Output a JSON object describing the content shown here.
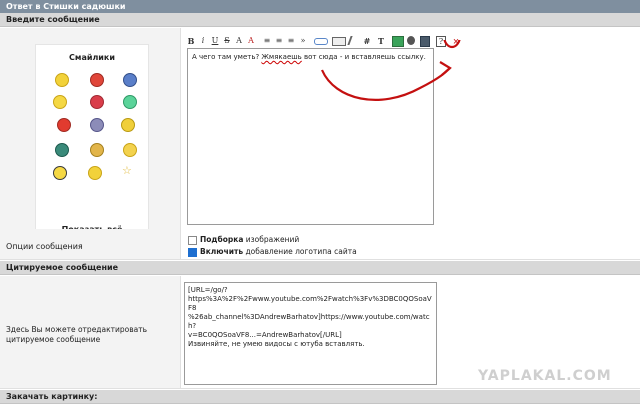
{
  "window": {
    "title": "Ответ в Стишки садюшки"
  },
  "sections": {
    "message": "Введите сообщение",
    "quoted": "Цитируемое сообщение",
    "upload": "Закачать картинку:"
  },
  "smileys": {
    "title": "Смайлики",
    "show_all": "Показать всё",
    "icons": [
      "smiley-icon",
      "smiley-icon",
      "smiley-icon",
      "smiley-icon",
      "smiley-icon",
      "smiley-icon",
      "smiley-icon",
      "smiley-icon",
      "smiley-icon",
      "smiley-icon",
      "smiley-icon",
      "smiley-icon",
      "smiley-icon",
      "smiley-icon",
      "smiley-icon",
      "star-icon"
    ]
  },
  "toolbar": {
    "bold": "B",
    "italic": "i",
    "underline": "U",
    "strike": "S",
    "text_size": "A",
    "text_color": "A",
    "align_left": "≡",
    "align_center": "≡",
    "align_right": "≡",
    "quote": "»",
    "hash": "#",
    "font": "T",
    "help": "?",
    "close": "×"
  },
  "editor": {
    "text_before": "А чего там уметь? ",
    "text_misspelled": "Жмякаешь",
    "text_after": " вот сюда - и вставляешь ссылку."
  },
  "options": {
    "label": "Опции сообщения",
    "opt1_bold": "Подборка",
    "opt1_rest": " изображений",
    "opt2_bold": "Включить",
    "opt2_rest": " добавление логотипа сайта"
  },
  "quote": {
    "label": "Здесь Вы можете отредактировать цитируемое сообщение",
    "line1": "[URL=/go/?",
    "line2": "https%3A%2F%2Fwww.youtube.com%2Fwatch%3Fv%3DBC0QOSoaVF8",
    "line3": "%26ab_channel%3DAndrewBarhatov]https://www.youtube.com/watch?",
    "line4": "v=BC0QOSoaVF8...=AndrewBarhatov[/URL]",
    "line5": "Извиняйте, не умею видосы с ютуба вставлять."
  },
  "watermark": "YAPLAKAL.COM",
  "colors": {
    "header": "#7f8f9f",
    "section": "#d8d8d8",
    "annotation": "#c41010",
    "checkbox": "#1e6fd0"
  }
}
